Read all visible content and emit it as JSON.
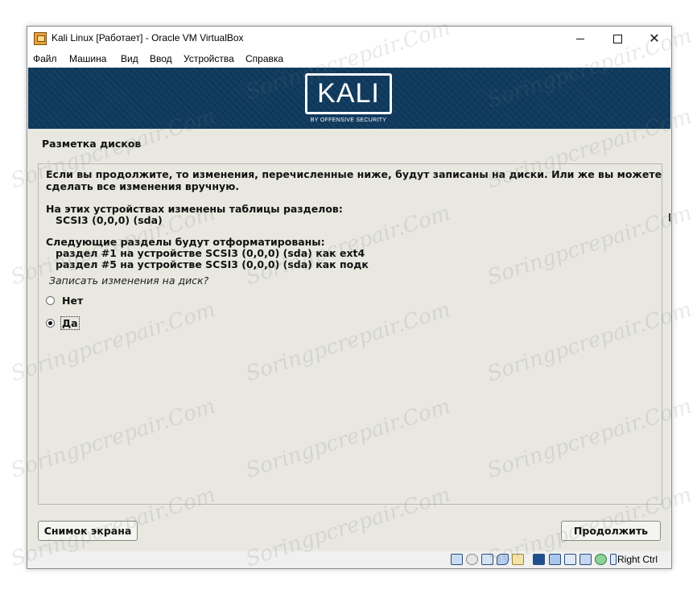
{
  "window": {
    "title": "Kali Linux [Работает] - Oracle VM VirtualBox",
    "menu": [
      "Файл",
      "Машина",
      "Вид",
      "Ввод",
      "Устройства",
      "Справка"
    ]
  },
  "banner": {
    "logo_text": "KALI",
    "logo_subtitle": "BY OFFENSIVE SECURITY"
  },
  "installer": {
    "section_title": "Разметка дисков",
    "intro_line1": "Если вы продолжите, то изменения, перечисленные ниже, будут записаны на диски. Или же вы можете",
    "intro_line2": "сделать все изменения вручную.",
    "tables_heading": "На этих устройствах изменены таблицы разделов:",
    "tables_device": "SCSI3 (0,0,0) (sda)",
    "format_heading": "Следующие разделы будут отформатированы:",
    "format_items": [
      "раздел #1 на устройстве SCSI3 (0,0,0) (sda) как ext4",
      "раздел #5 на устройстве SCSI3 (0,0,0) (sda) как подк"
    ],
    "question": "Записать изменения на диск?",
    "options": [
      {
        "label": "Нет",
        "selected": false
      },
      {
        "label": "Да",
        "selected": true
      }
    ],
    "screenshot_button": "Снимок экрана",
    "continue_button": "Продолжить"
  },
  "statusbar": {
    "host_key": "Right Ctrl",
    "icons": [
      "hard-disk-icon",
      "optical-drive-icon",
      "usb-icon",
      "audio-icon",
      "shared-folders-icon",
      "display-icon",
      "network-icon",
      "video-capture-icon",
      "cpu-icon",
      "mouse-integration-icon",
      "keyboard-icon"
    ]
  },
  "watermark": "Soringpcrepair.Com",
  "colors": {
    "banner_bg": "#0f3a5e",
    "installer_bg": "#e8e8e0"
  }
}
